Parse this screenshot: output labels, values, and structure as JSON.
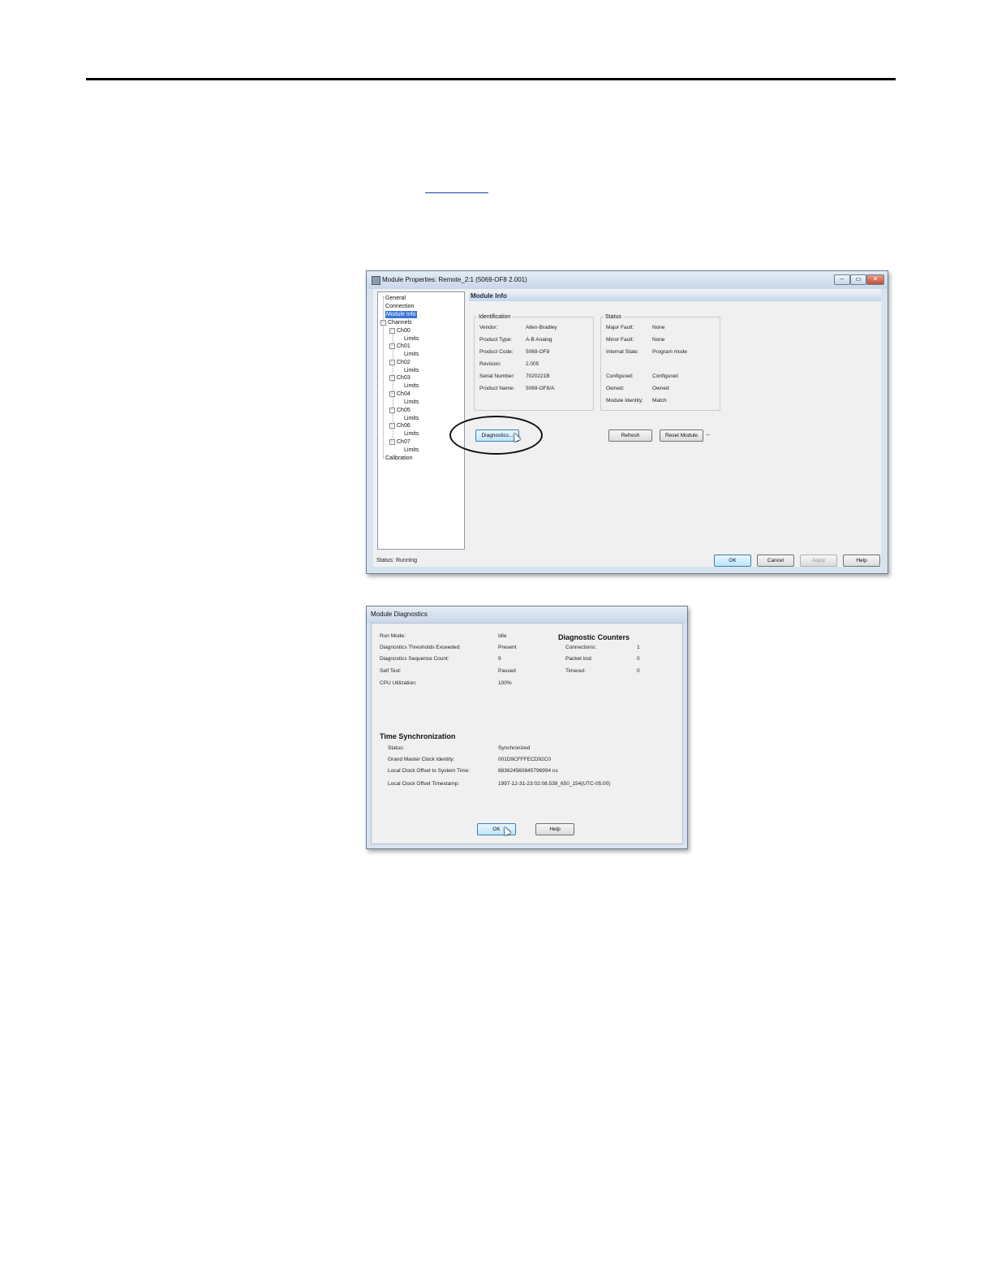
{
  "module_properties": {
    "title": "Module Properties: Remote_2:1 (5069-OF8 2.001)",
    "window_buttons": {
      "minimize": "–",
      "maximize": "▭",
      "close": "✕"
    },
    "tree": {
      "general": "General",
      "connection": "Connection",
      "module_info": "Module Info",
      "channels": "Channels",
      "ch00": "Ch00",
      "ch01": "Ch01",
      "ch02": "Ch02",
      "ch03": "Ch03",
      "ch04": "Ch04",
      "ch05": "Ch05",
      "ch06": "Ch06",
      "ch07": "Ch07",
      "limits": "Limits",
      "calibration": "Calibration",
      "expander": "−"
    },
    "section_title": "Module Info",
    "identification": {
      "title": "Identification",
      "vendor_label": "Vendor:",
      "vendor": "Allen-Bradley",
      "product_type_label": "Product Type:",
      "product_type": "A-B Analog",
      "product_code_label": "Product Code:",
      "product_code": "5069-OF8",
      "revision_label": "Revision:",
      "revision": "2.005",
      "serial_label": "Serial Number:",
      "serial": "7020221B",
      "product_name_label": "Product Name:",
      "product_name": "5069-OF8/A"
    },
    "status": {
      "title": "Status",
      "major_fault_label": "Major Fault:",
      "major_fault": "None",
      "minor_fault_label": "Minor Fault:",
      "minor_fault": "None",
      "internal_state_label": "Internal State:",
      "internal_state": "Program mode",
      "configured_label": "Configured:",
      "configured": "Configured",
      "owned_label": "Owned:",
      "owned": "Owned",
      "identity_label": "Module Identity:",
      "identity": "Match"
    },
    "buttons": {
      "diagnostics": "Diagnostics...",
      "refresh": "Refresh",
      "reset_module": "Reset Module",
      "ok": "OK",
      "cancel": "Cancel",
      "apply": "Apply",
      "help": "Help"
    },
    "reset_arrow": "←",
    "status_bar": {
      "label": "Status:",
      "value": "Running"
    }
  },
  "module_diagnostics": {
    "title": "Module Diagnostics",
    "run_mode_label": "Run Mode:",
    "run_mode": "Idle",
    "thresholds_label": "Diagnostics Thresholds Exceeded:",
    "thresholds": "Present",
    "sequence_label": "Diagnostics Sequence Count:",
    "sequence": "9",
    "self_test_label": "Self Test:",
    "self_test": "Passed",
    "cpu_label": "CPU Utilization:",
    "cpu": "100%",
    "counters": {
      "title": "Diagnostic Counters",
      "connections_label": "Connections:",
      "connections": "1",
      "packet_lost_label": "Packet lost:",
      "packet_lost": "0",
      "timeout_label": "Timeout:",
      "timeout": "0"
    },
    "time_sync": {
      "title": "Time Synchronization",
      "status_label": "Status:",
      "status": "Synchronized",
      "gm_label": "Grand Master Clock Identity:",
      "gm": "001D9CFFFECD92C0",
      "offset_label": "Local Clock Offset to System Time:",
      "offset": "883624560845796994 ns",
      "timestamp_label": "Local Clock Offset Timestamp:",
      "timestamp": "1997-12-31-23:02:08.539_650_154(UTC-05:00)"
    },
    "buttons": {
      "ok": "OK",
      "help": "Help"
    }
  }
}
